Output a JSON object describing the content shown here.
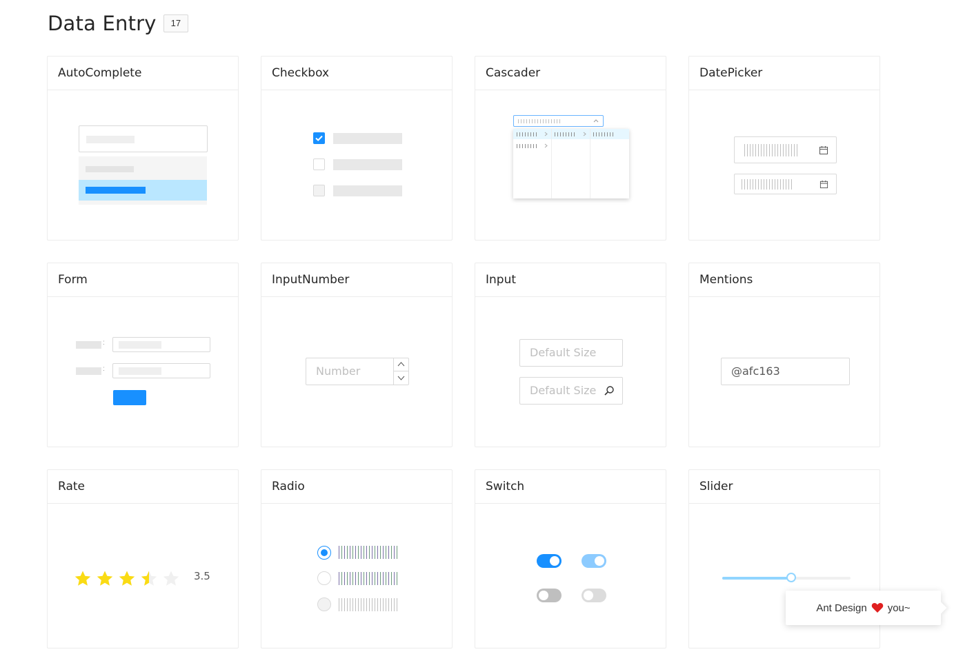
{
  "page": {
    "title": "Data Entry",
    "count": "17"
  },
  "cards": {
    "autocomplete": {
      "title": "AutoComplete"
    },
    "checkbox": {
      "title": "Checkbox"
    },
    "cascader": {
      "title": "Cascader"
    },
    "datepicker": {
      "title": "DatePicker"
    },
    "form": {
      "title": "Form"
    },
    "inputnumber": {
      "title": "InputNumber",
      "placeholder": "Number"
    },
    "input": {
      "title": "Input",
      "placeholder_1": "Default Size",
      "placeholder_2": "Default Size"
    },
    "mentions": {
      "title": "Mentions",
      "value": "@afc163"
    },
    "rate": {
      "title": "Rate",
      "value": "3.5",
      "stars": 5,
      "rating": 3.5
    },
    "radio": {
      "title": "Radio"
    },
    "switch": {
      "title": "Switch"
    },
    "slider": {
      "title": "Slider",
      "value_fraction": 0.54
    }
  },
  "toast": {
    "text_before": "Ant Design",
    "text_after": "you~"
  },
  "colors": {
    "primary": "#1890ff",
    "light_primary": "#bae7ff",
    "star": "#fadb14",
    "heart": "#e02020"
  },
  "icons": {
    "calendar": "calendar-icon",
    "search": "search-icon",
    "heart": "heart-icon",
    "star": "star-icon"
  }
}
